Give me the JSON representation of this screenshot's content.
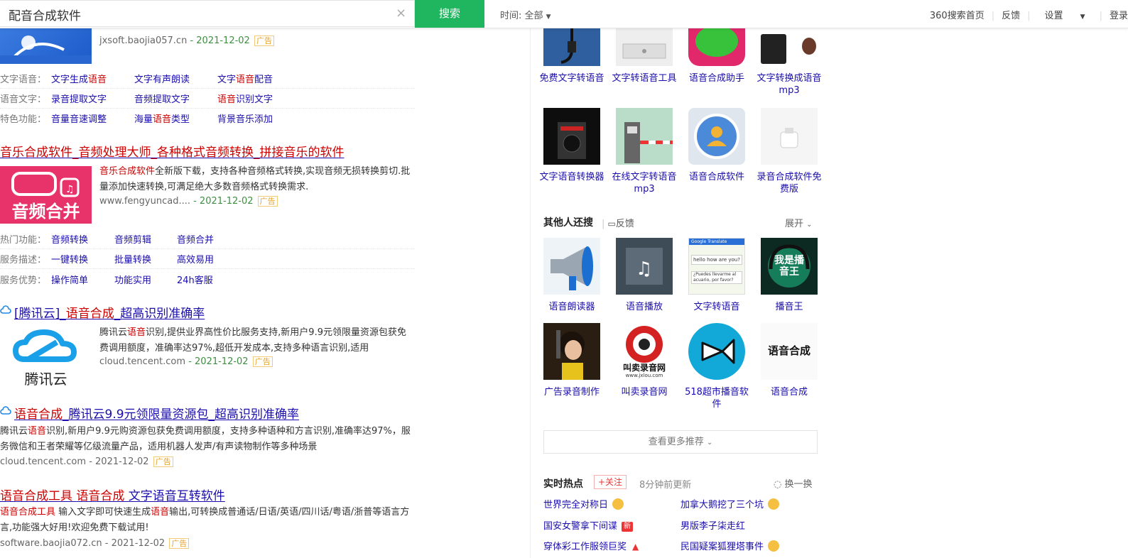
{
  "search": {
    "query": "配音合成软件",
    "button_label": "搜索",
    "time_filter": "时间: 全部"
  },
  "top_links": [
    "360搜索首页",
    "反馈",
    "设置",
    "登录"
  ],
  "result1": {
    "url": "jxsoft.baojia057.cn",
    "date": "- 2021-12-02",
    "ad": "广告",
    "features": [
      {
        "label": "文字语音：",
        "links": [
          [
            "文字生成",
            "语音",
            ""
          ],
          [
            "文字有声朗读",
            "",
            ""
          ],
          [
            "文字",
            "语音",
            "配音"
          ]
        ]
      },
      {
        "label": "语音文字：",
        "links": [
          [
            "录音提取文字",
            "",
            ""
          ],
          [
            "音频提取文字",
            "",
            ""
          ],
          [
            "",
            "语音",
            "识别文字"
          ]
        ]
      },
      {
        "label": "特色功能：",
        "links": [
          [
            "音量音速调整",
            "",
            ""
          ],
          [
            "海量",
            "语音",
            "类型"
          ],
          [
            "背景音乐添加",
            "",
            ""
          ]
        ]
      }
    ]
  },
  "result2": {
    "title": "音乐合成软件_音频处理大师_各种格式音频转换_拼接音乐的软件",
    "image_text": "音频合并",
    "desc_hl": "音乐合成软件",
    "desc": "全新版下载，支持各种音频格式转换,实现音频无损转换剪切.批量添加快速转换,可满足绝大多数音频格式转换需求.",
    "url": "www.fengyuncad....",
    "date": "- 2021-12-02",
    "ad": "广告",
    "features": [
      {
        "label": "热门功能：",
        "links": [
          "音频转换",
          "音频剪辑",
          "音频合并"
        ]
      },
      {
        "label": "服务描述：",
        "links": [
          "一键转换",
          "批量转换",
          "高效易用"
        ]
      },
      {
        "label": "服务优势：",
        "links": [
          "操作简单",
          "功能实用",
          "24h客服"
        ]
      }
    ]
  },
  "result3": {
    "title_pre": "[腾讯云]_",
    "title_hl": "语音合成",
    "title_post": "_超高识别准确率",
    "image_text": "腾讯云",
    "desc_pre": "腾讯云",
    "desc_hl": "语音",
    "desc": "识别,提供业界高性价比服务支持,新用户9.9元领限量资源包获免费调用额度，准确率达97%,超低开发成本,支持多种语言识别,适用",
    "url": "cloud.tencent.com",
    "date": "- 2021-12-02",
    "ad": "广告"
  },
  "result4": {
    "title_hl": "语音合成",
    "title_post": "_腾讯云9.9元领限量资源包_超高识别准确率",
    "desc_pre": "腾讯云",
    "desc_hl": "语音",
    "desc": "识别,新用户9.9元购资源包获免费调用额度，支持多种语种和方言识别,准确率达97%，服务微信和王者荣耀等亿级流量产品，适用机器人发声/有声读物制作等多种场景",
    "url": "cloud.tencent.com",
    "date": "- 2021-12-02",
    "ad": "广告"
  },
  "result5": {
    "title_hl1": "语音合成工具",
    "title_sp": " ",
    "title_hl2": "语音合成",
    "title_post": " 文字语音互转软件",
    "desc_hl": "语音合成工具",
    "desc_a": " 输入文字即可快速生成",
    "desc_hl2": "语音",
    "desc_b": "输出,可转换成普通话/日语/英语/四川话/粤语/浙普等语言方言,功能强大好用!欢迎免费下载试用!",
    "url": "software.baojia072.cn",
    "date": "- 2021-12-02",
    "ad": "广告"
  },
  "related_top": [
    "免费文字转语音",
    "文字转语音工具",
    "语音合成助手",
    "文字转换成语音mp3"
  ],
  "related_mid": [
    "文字语音转换器",
    "在线文字转语音mp3",
    "语音合成软件",
    "录音合成软件免费版"
  ],
  "others": {
    "title": "其他人还搜",
    "feedback": "反馈",
    "expand": "展开",
    "row1": [
      "语音朗读器",
      "语音播放",
      "文字转语音",
      "播音王"
    ],
    "row2": [
      "广告录音制作",
      "叫卖录音网",
      "518超市播音软件",
      "语音合成"
    ],
    "tile_texts": {
      "bobo": "我是播音王",
      "jiamai": "叫卖录音网",
      "jiamai_url": "www.jxlou.com",
      "hecheng": "语音合成",
      "translate_hello": "hello how are you?",
      "translate_es": "¿Puedes llevarme al acuario, por favor?",
      "translate_header": "Google Translate"
    },
    "more": "查看更多推荐"
  },
  "hot": {
    "title": "实时热点",
    "follow": "+关注",
    "updated": "8分钟前更新",
    "refresh": "换一换",
    "items": [
      "世界完全对称日",
      "加拿大鹅挖了三个坑",
      "国安女警拿下间谍",
      "男版李子柒走红",
      "穿体彩工作服领巨奖",
      "民国疑案狐狸塔事件"
    ],
    "new_badge": "新"
  },
  "colors": {
    "green": "#20b660",
    "link": "#1a0dab",
    "highlight": "#cc0000",
    "date": "#3e8e41"
  }
}
